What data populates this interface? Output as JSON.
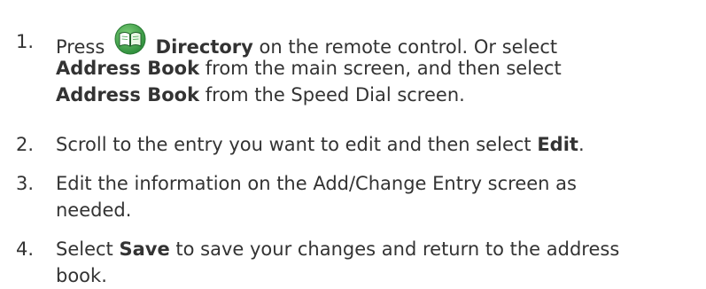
{
  "steps": [
    {
      "number": "1.",
      "line1_a": "Press",
      "icon": "directory-book-icon",
      "line1_b": "Directory",
      "line1_c": "on the remote control. Or select",
      "line2_a": "Address Book",
      "line2_b": "from the main screen, and then select",
      "line3_a": "Address Book",
      "line3_b": "from the Speed Dial screen."
    },
    {
      "number": "2.",
      "line1_a": "Scroll to the entry you want to edit and then select",
      "line1_b": "Edit",
      "line1_c": "."
    },
    {
      "number": "3.",
      "line1": "Edit the information on the Add/Change Entry screen as",
      "line2": "needed."
    },
    {
      "number": "4.",
      "line1_a": "Select",
      "line1_b": "Save",
      "line1_c": "to save your changes and return to the address",
      "line2": "book."
    }
  ],
  "colors": {
    "text": "#333333",
    "icon_green": "#3fa14a",
    "icon_light": "#d8f0d0"
  }
}
